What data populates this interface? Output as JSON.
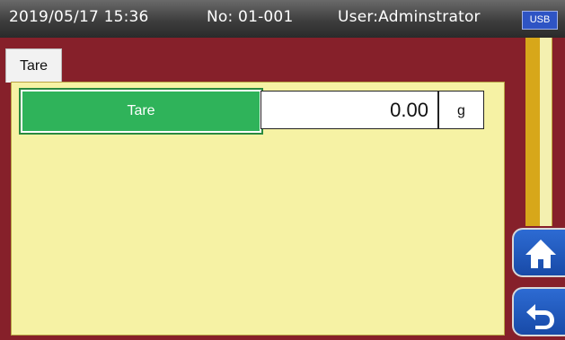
{
  "status_bar": {
    "datetime": "2019/05/17 15:36",
    "number": "No: 01-001",
    "user": "User:Adminstrator",
    "usb_badge": "USB"
  },
  "tabs": [
    {
      "label": "Tare"
    }
  ],
  "tare": {
    "button_label": "Tare",
    "value": "0.00",
    "unit": "g"
  },
  "navigation": {
    "home_icon": "home-icon",
    "back_icon": "back-arrow-icon"
  },
  "colors": {
    "frame": "#86202a",
    "panel": "#f6f2a4",
    "tare_button": "#2fb35a",
    "nav_button": "#2d6bd3",
    "scroll_thumb": "#d7a71a"
  }
}
